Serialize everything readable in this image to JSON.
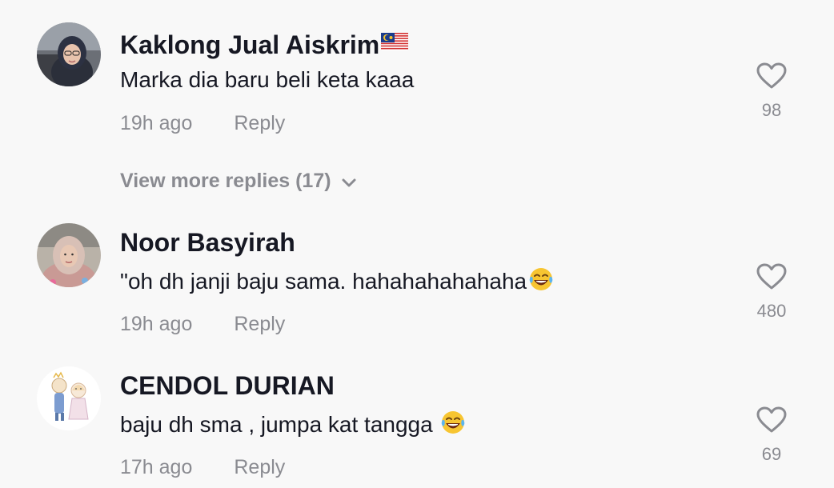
{
  "comments": [
    {
      "username": "Kaklong Jual Aiskrim",
      "text": "Marka dia baru beli keta kaaa",
      "time": "19h ago",
      "reply_label": "Reply",
      "likes": "98",
      "flag_icon": "malaysia-flag-icon"
    },
    {
      "username": "Noor Basyirah",
      "text": "\"oh dh janji baju sama. hahahahahahaha",
      "time": "19h ago",
      "reply_label": "Reply",
      "likes": "480",
      "emoji_icon": "laughing-tears-emoji-icon"
    },
    {
      "username": "CENDOL DURIAN",
      "text": "baju dh sma , jumpa kat tangga ",
      "time": "17h ago",
      "reply_label": "Reply",
      "likes": "69",
      "emoji_icon": "laughing-tears-emoji-icon"
    }
  ],
  "view_more_replies": "View more replies (17)",
  "colors": {
    "background": "#f8f8f8",
    "primary_text": "#161823",
    "secondary_text": "#8a8b91"
  }
}
